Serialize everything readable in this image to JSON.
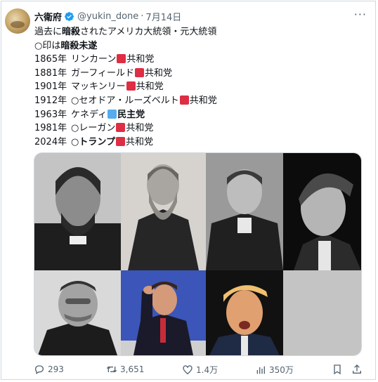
{
  "tweet": {
    "name": "六衛府",
    "handle": "@yukin_done",
    "separator": "·",
    "date": "7月14日",
    "more": "···",
    "line1_prefix": "過去に",
    "line1_bold": "暗殺",
    "line1_suffix": "されたアメリカ大統領・元大統領",
    "line2_prefix": "○印は",
    "line2_bold": "暗殺未遂",
    "presidents": [
      {
        "year": "1865年",
        "name": "リンカーン",
        "party": "共和党"
      },
      {
        "year": "1881年",
        "name": "ガーフィールド",
        "party": "共和党"
      },
      {
        "year": "1901年",
        "name": "マッキンリー",
        "party": "共和党"
      },
      {
        "year": "1912年",
        "name": "○セオドア・ルーズベルト",
        "party": "共和党"
      },
      {
        "year": "1963年",
        "name": "ケネディ",
        "party": "民主党"
      },
      {
        "year": "1981年",
        "name": "○レーガン",
        "party": "共和党"
      },
      {
        "year": "2024年",
        "name_prefix": "○",
        "name_bold": "トランプ",
        "party": "共和党"
      }
    ]
  },
  "actions": {
    "replies": "293",
    "retweets": "3,651",
    "likes": "1.4万",
    "views": "350万"
  },
  "colors": {
    "republican": "#dd2e44",
    "democrat": "#55acee",
    "verified": "#1d9bf0",
    "secondary_text": "#536471"
  }
}
